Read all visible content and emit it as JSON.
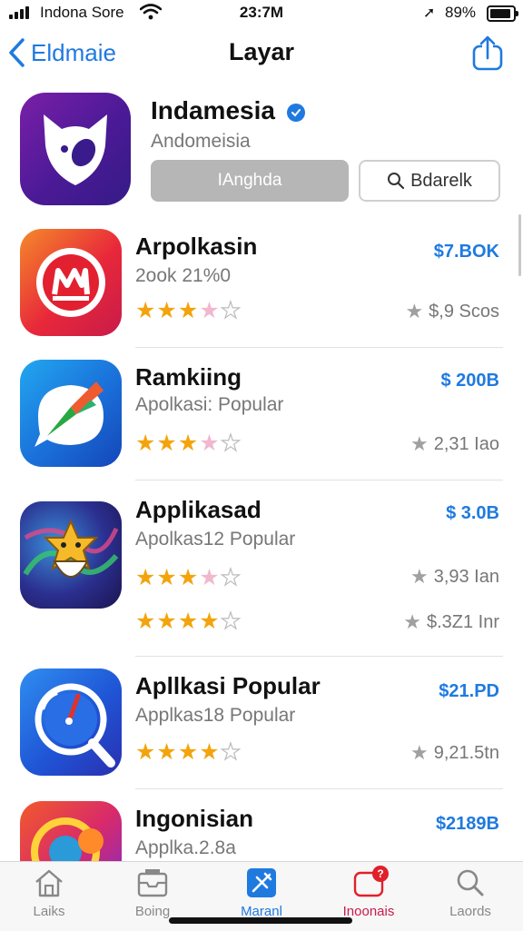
{
  "status_bar": {
    "carrier": "Indona Sore",
    "time": "23:7M",
    "battery": "89%"
  },
  "nav": {
    "back_label": "Eldmaie",
    "title": "Layar"
  },
  "featured": {
    "name": "Indamesia",
    "subtitle": "Andomeisia",
    "primary_button": "IAnghda",
    "search_button": "Bdarelk"
  },
  "apps": [
    {
      "name": "Arpolkasin",
      "subtitle": "2ook 21%0",
      "price": "$7.BOK",
      "ratings": [
        {
          "stars": [
            "full",
            "full",
            "full",
            "pink",
            "empty"
          ],
          "count": "$,9 Scos"
        }
      ]
    },
    {
      "name": "Ramkiing",
      "subtitle": "Apolkasi: Popular",
      "price": "$ 200B",
      "ratings": [
        {
          "stars": [
            "full",
            "full",
            "full",
            "pink",
            "empty"
          ],
          "count": "2,31 Iao"
        }
      ]
    },
    {
      "name": "Applikasad",
      "subtitle": "Apolkas12 Popular",
      "price": "$ 3.0B",
      "ratings": [
        {
          "stars": [
            "full",
            "full",
            "full",
            "pink",
            "empty"
          ],
          "count": "3,93 Ian"
        },
        {
          "stars": [
            "full",
            "full",
            "full",
            "full",
            "empty"
          ],
          "count": "$.3Z1 Inr"
        }
      ]
    },
    {
      "name": "Apllkasi Popular",
      "subtitle": "Applkas18 Popular",
      "price": "$21.PD",
      "ratings": [
        {
          "stars": [
            "full",
            "full",
            "full",
            "full",
            "empty"
          ],
          "count": "9,21.5tn"
        }
      ]
    },
    {
      "name": "Ingonisian",
      "subtitle": "Applka.2.8a",
      "price": "$2189B",
      "ratings": []
    }
  ],
  "tabs": [
    {
      "label": "Laiks",
      "icon": "home-icon"
    },
    {
      "label": "Boing",
      "icon": "inbox-icon"
    },
    {
      "label": "Maranl",
      "icon": "app-store-icon",
      "active": true
    },
    {
      "label": "Inoonais",
      "icon": "updates-icon",
      "badge": "?"
    },
    {
      "label": "Laords",
      "icon": "search-icon"
    }
  ],
  "colors": {
    "accent": "#1f7ae0",
    "star": "#f3a40c",
    "badge": "#e0202a"
  }
}
